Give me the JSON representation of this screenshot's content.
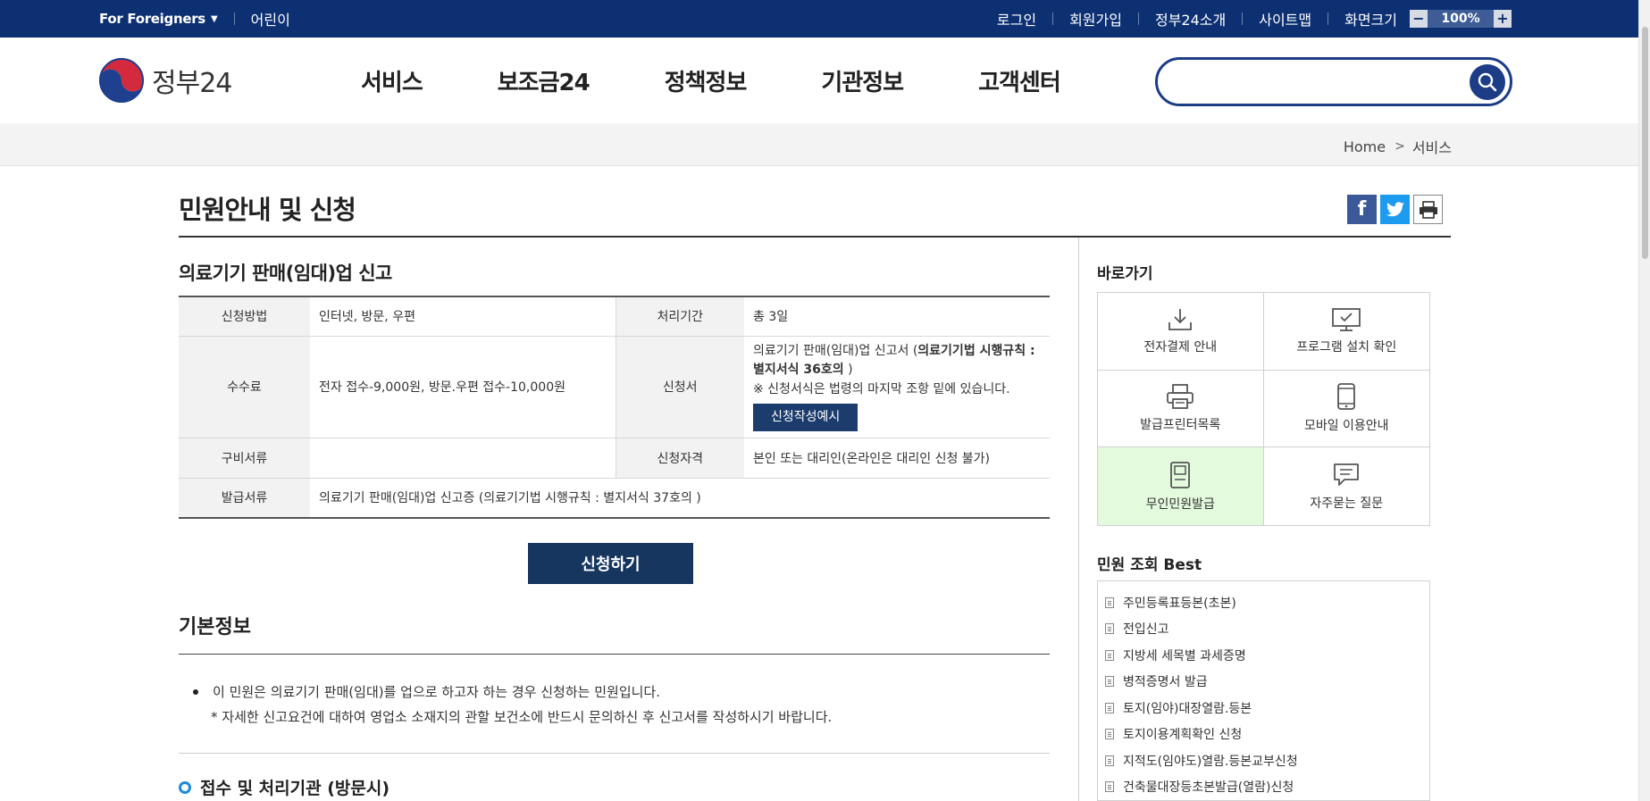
{
  "topbar": {
    "foreigners": "For Foreigners",
    "kids": "어린이",
    "links": [
      "로그인",
      "회원가입",
      "정부24소개",
      "사이트맵"
    ],
    "screen_size_label": "화면크기",
    "zoom_minus": "−",
    "zoom_value": "100%",
    "zoom_plus": "+"
  },
  "header": {
    "logo_text": "정부24",
    "nav": [
      "서비스",
      "보조금24",
      "정책정보",
      "기관정보",
      "고객센터"
    ],
    "search_placeholder": ""
  },
  "breadcrumb": {
    "home": "Home",
    "current": "서비스"
  },
  "page": {
    "title": "민원안내 및 신청"
  },
  "service": {
    "title": "의료기기 판매(임대)업 신고",
    "rows": {
      "method_label": "신청방법",
      "method_value": "인터넷, 방문, 우편",
      "period_label": "처리기간",
      "period_value": "총 3일",
      "fee_label": "수수료",
      "fee_value": "전자 접수-9,000원, 방문.우편 접수-10,000원",
      "form_label": "신청서",
      "form_value_prefix": "의료기기 판매(임대)업 신고서 (",
      "form_value_bold": "의료기기법 시행규칙 : 별지서식 36호의",
      "form_value_suffix": " )",
      "form_note": "※ 신청서식은 법령의 마지막 조항 밑에 있습니다.",
      "form_button": "신청작성예시",
      "docs_label": "구비서류",
      "docs_value": "",
      "qual_label": "신청자격",
      "qual_value": "본인 또는 대리인(온라인은 대리인 신청 불가)",
      "issue_label": "발급서류",
      "issue_value": "의료기기 판매(임대)업 신고증 (의료기기법 시행규칙 : 별지서식 37호의 )"
    },
    "apply_button": "신청하기"
  },
  "basic_info": {
    "title": "기본정보",
    "bullet": "이 민원은 의료기기 판매(임대)를 업으로 하고자 하는 경우 신청하는 민원입니다.",
    "note": "* 자세한 신고요건에 대하여 영업소 소재지의 관할 보건소에 반드시 문의하신 후 신고서를 작성하시기 바랍니다.",
    "sub_title": "접수 및 처리기관 (방문시)"
  },
  "sidebar": {
    "quick_title": "바로가기",
    "quick_links": [
      {
        "label": "전자결제 안내",
        "icon": "download-tray-icon"
      },
      {
        "label": "프로그램 설치 확인",
        "icon": "monitor-check-icon"
      },
      {
        "label": "발급프린터목록",
        "icon": "printer-icon"
      },
      {
        "label": "모바일 이용안내",
        "icon": "mobile-phone-icon"
      },
      {
        "label": "무인민원발급",
        "icon": "kiosk-icon"
      },
      {
        "label": "자주묻는 질문",
        "icon": "speech-bubble-icon"
      }
    ],
    "best_title": "민원 조회 Best",
    "best_list": [
      "주민등록표등본(초본)",
      "전입신고",
      "지방세 세목별 과세증명",
      "병적증명서 발급",
      "토지(임야)대장열람.등본",
      "토지이용계획확인 신청",
      "지적도(임야도)열람.등본교부신청",
      "건축물대장등초본발급(열람)신청"
    ]
  },
  "colors": {
    "topbar_bg": "#0d3073",
    "accent": "#1d3c86",
    "button_bg": "#16365f",
    "kiosk_highlight": "#e3fadd"
  }
}
